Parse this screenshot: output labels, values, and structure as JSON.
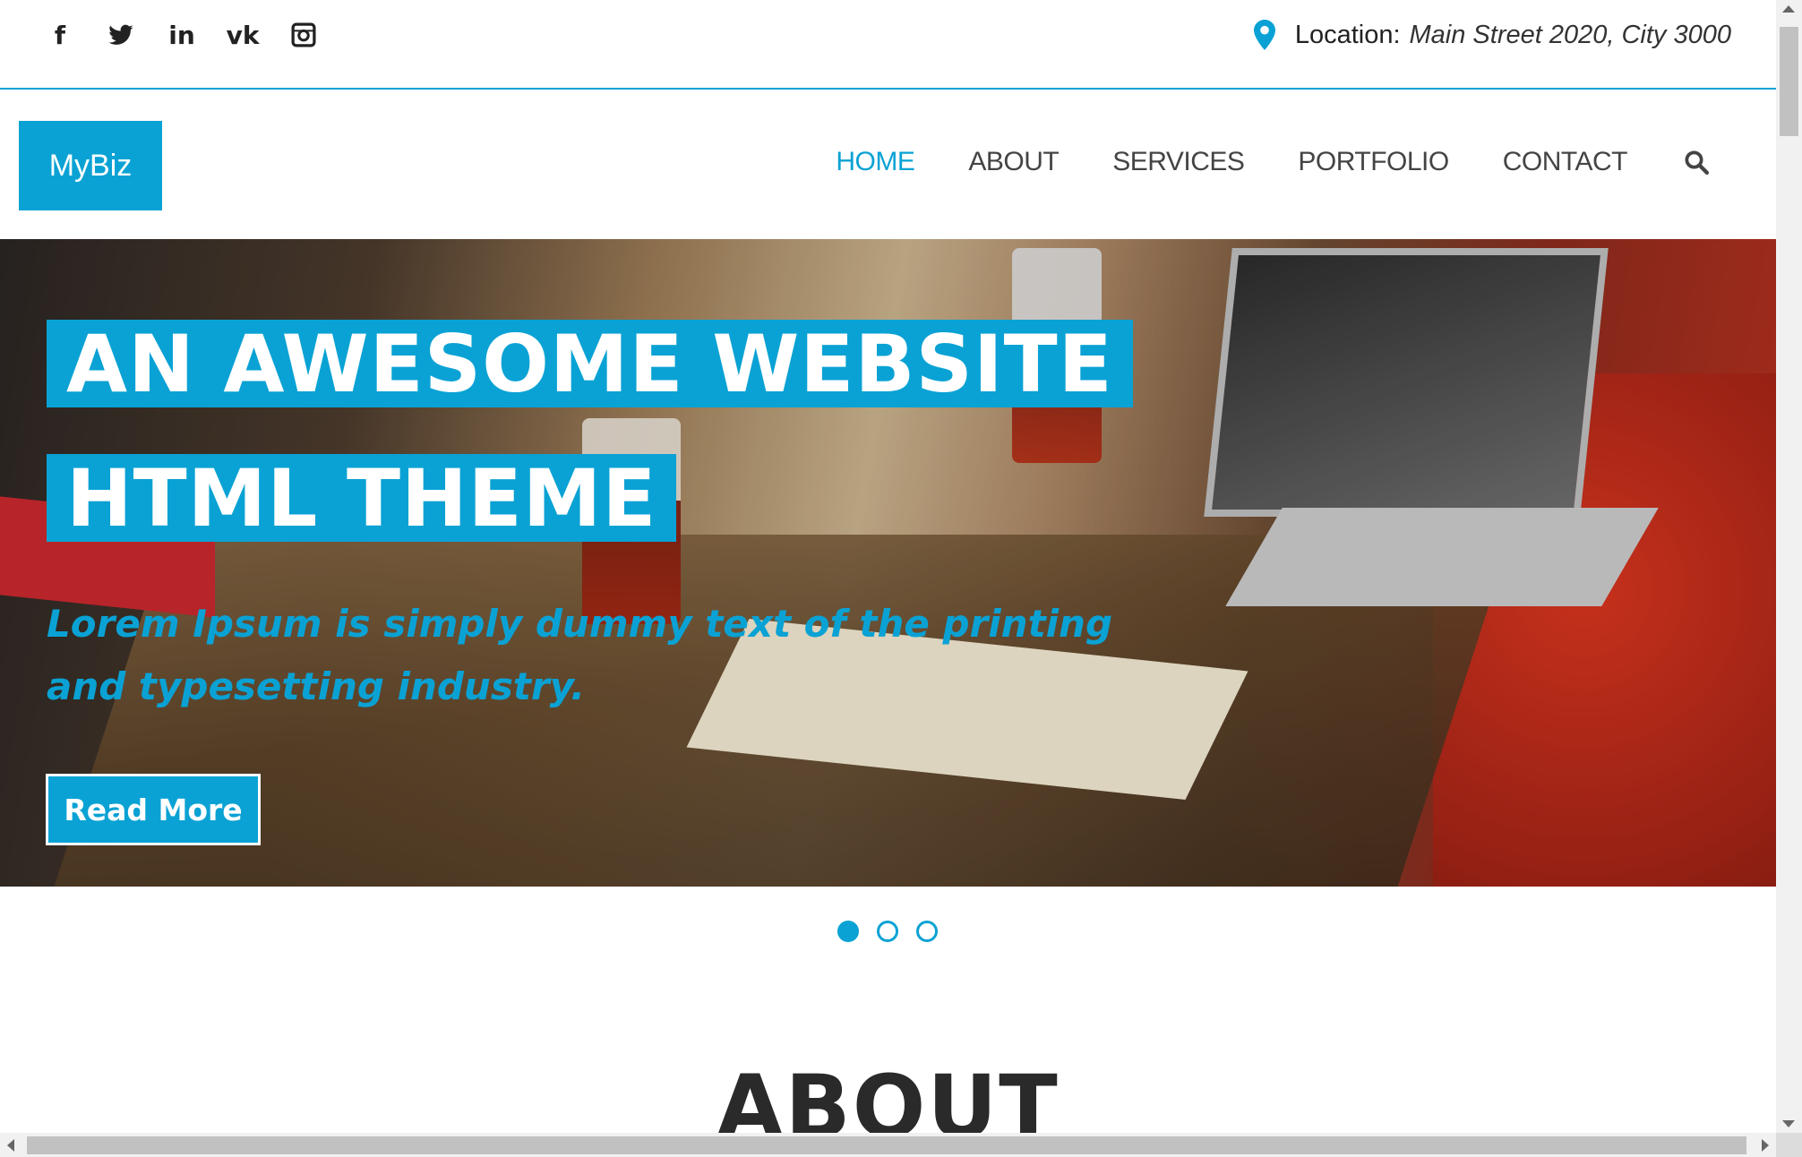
{
  "topbar": {
    "social_icons": [
      "facebook-icon",
      "twitter-icon",
      "linkedin-icon",
      "vk-icon",
      "instagram-icon"
    ],
    "facebook_glyph": "f",
    "linkedin_glyph": "in",
    "vk_glyph": "vk",
    "location_label": "Location:",
    "location_value": "Main Street 2020, City 3000"
  },
  "header": {
    "logo": "MyBiz",
    "nav": [
      {
        "label": "HOME",
        "active": true
      },
      {
        "label": "ABOUT",
        "active": false
      },
      {
        "label": "SERVICES",
        "active": false
      },
      {
        "label": "PORTFOLIO",
        "active": false
      },
      {
        "label": "CONTACT",
        "active": false
      }
    ]
  },
  "hero": {
    "title_line1": "AN AWESOME WEBSITE",
    "title_line2": "HTML THEME",
    "subtitle": "Lorem Ipsum is simply dummy text of the printing and typesetting industry.",
    "button": "Read More",
    "slides_total": 3,
    "active_slide": 1
  },
  "section": {
    "title": "ABOUT"
  },
  "colors": {
    "accent": "#0aa2d4",
    "text": "#444444"
  }
}
